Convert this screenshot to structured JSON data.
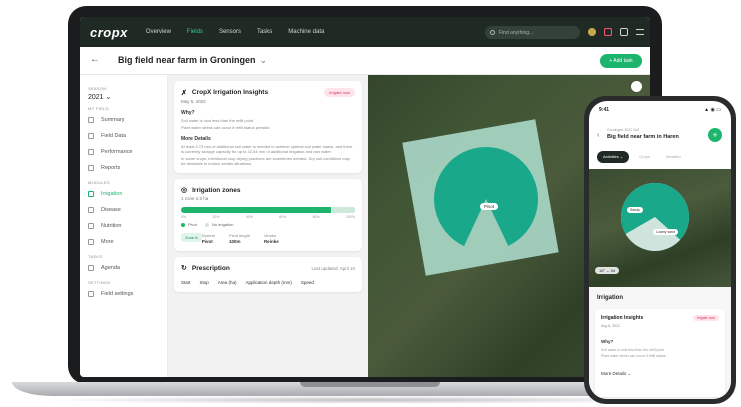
{
  "nav": {
    "logo": "cropx",
    "links": [
      "Overview",
      "Fields",
      "Sensors",
      "Tasks",
      "Machine data"
    ],
    "active_index": 1,
    "search_placeholder": "Find anything..."
  },
  "header": {
    "back": "←",
    "title": "Big field near farm in Groningen",
    "chevron": "⌄",
    "add_label": "+ Add task"
  },
  "sidebar": {
    "season_label": "SEASON",
    "year": "2021 ⌄",
    "field_label": "MY FIELD",
    "field_items": [
      "Summary",
      "Field Data",
      "Performance",
      "Reports"
    ],
    "modules_label": "MODULES",
    "module_items": [
      "Irrigation",
      "Disease",
      "Nutrition",
      "More"
    ],
    "active_module": "Irrigation",
    "tasks_label": "TASKS",
    "task_items": [
      "Agenda"
    ],
    "settings_label": "SETTINGS",
    "settings_items": [
      "Field settings"
    ]
  },
  "insights": {
    "title": "CropX Irrigation Insights",
    "badge": "Irrigate now",
    "date": "May 5, 2022",
    "why_title": "Why?",
    "why_items": [
      "Soil water is now less than the refill point",
      "Plant water stress can occur if refill status persists"
    ],
    "more_title": "More Details",
    "more_items": [
      "At least 0.73 mm of additional soil water is needed to achieve optimal soil water status, and there is currently storage capacity for up to 42.54 mm of additional irrigation and rain water.",
      "In some crops, intentional crop drying practices are sometimes needed. Dry soil conditions may be desirable to induce certain situations."
    ]
  },
  "zones": {
    "title": "Irrigation zones",
    "zone_label": "1 zone",
    "zone_area": "2.5 ha",
    "scale": [
      "0%",
      "20%",
      "40%",
      "60%",
      "80%",
      "100%"
    ],
    "pivot_pct": 86,
    "legend_pivot": "Pivot",
    "legend_none": "No irrigation",
    "zone_chip": "Zone A",
    "system_label": "System",
    "system_value": "Pivot",
    "length_label": "Pivot length",
    "length_value": "100m",
    "vendor_label": "Vendor",
    "vendor_value": "Reinke"
  },
  "prescription": {
    "title": "Prescription",
    "updated": "Last updated: April 10",
    "columns": [
      "Start",
      "Stop",
      "Area (ha)",
      "Application depth (mm)",
      "Speed"
    ]
  },
  "map": {
    "pivot_label": "Pivot",
    "pivot_share": 0.86
  },
  "phone": {
    "time": "9:41",
    "signal": "▲ ◉ ▭",
    "crumb": "Groningen 2022 Soil",
    "title": "Big field near farm in Haren",
    "add": "+",
    "tabs": [
      "Activities ⌄",
      "Crops",
      "Weather"
    ],
    "map_label_1": "Sandy",
    "map_label_2": "Loamy sand",
    "weather": "18° ⌄ 5d",
    "section": "Irrigation",
    "card_title": "Irrigation Insights",
    "card_badge": "Irrigate now",
    "card_date": "Aug 6, 2022",
    "why": "Why?",
    "line1": "Soil water is now less than the refill point",
    "line2": "Plant water stress can occur if refill status...",
    "more": "More Details ⌄"
  },
  "colors": {
    "accent": "#1db56d",
    "pivot": "#1aa88a",
    "badge_bg": "#ffe3ea",
    "badge_text": "#d9345c",
    "nav_bg": "#1f2a24"
  }
}
